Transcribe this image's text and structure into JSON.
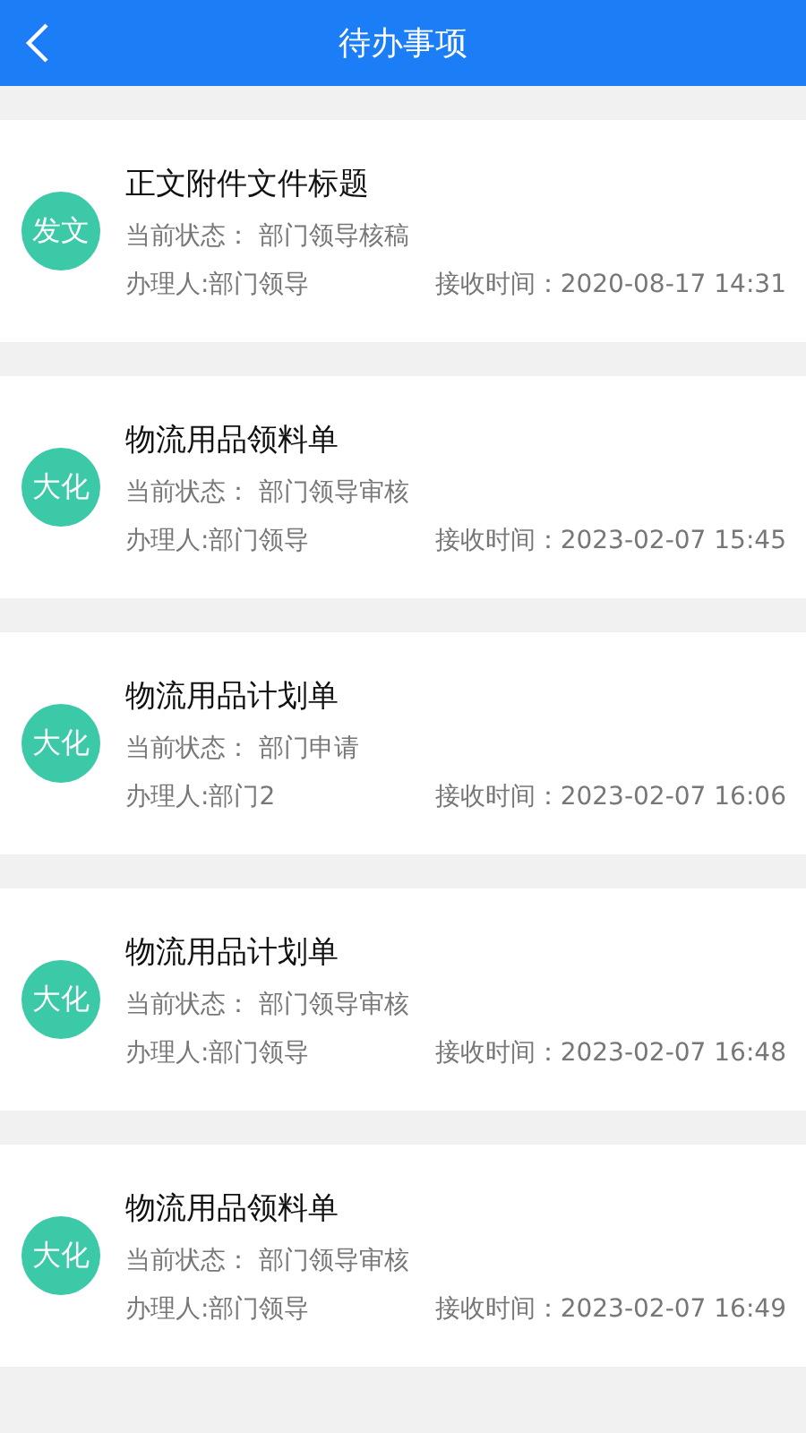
{
  "header": {
    "title": "待办事项"
  },
  "items": [
    {
      "badge": "发文",
      "title": "正文附件文件标题",
      "status_label": "当前状态：",
      "status": "部门领导核稿",
      "handler": "办理人:部门领导",
      "received_label": "接收时间：",
      "received": "2020-08-17 14:31"
    },
    {
      "badge": "大化",
      "title": "物流用品领料单",
      "status_label": "当前状态：",
      "status": "部门领导审核",
      "handler": "办理人:部门领导",
      "received_label": "接收时间：",
      "received": "2023-02-07 15:45"
    },
    {
      "badge": "大化",
      "title": "物流用品计划单",
      "status_label": "当前状态：",
      "status": "部门申请",
      "handler": "办理人:部门2",
      "received_label": "接收时间：",
      "received": "2023-02-07 16:06"
    },
    {
      "badge": "大化",
      "title": "物流用品计划单",
      "status_label": "当前状态：",
      "status": "部门领导审核",
      "handler": "办理人:部门领导",
      "received_label": "接收时间：",
      "received": "2023-02-07 16:48"
    },
    {
      "badge": "大化",
      "title": "物流用品领料单",
      "status_label": "当前状态：",
      "status": "部门领导审核",
      "handler": "办理人:部门领导",
      "received_label": "接收时间：",
      "received": "2023-02-07 16:49"
    }
  ]
}
